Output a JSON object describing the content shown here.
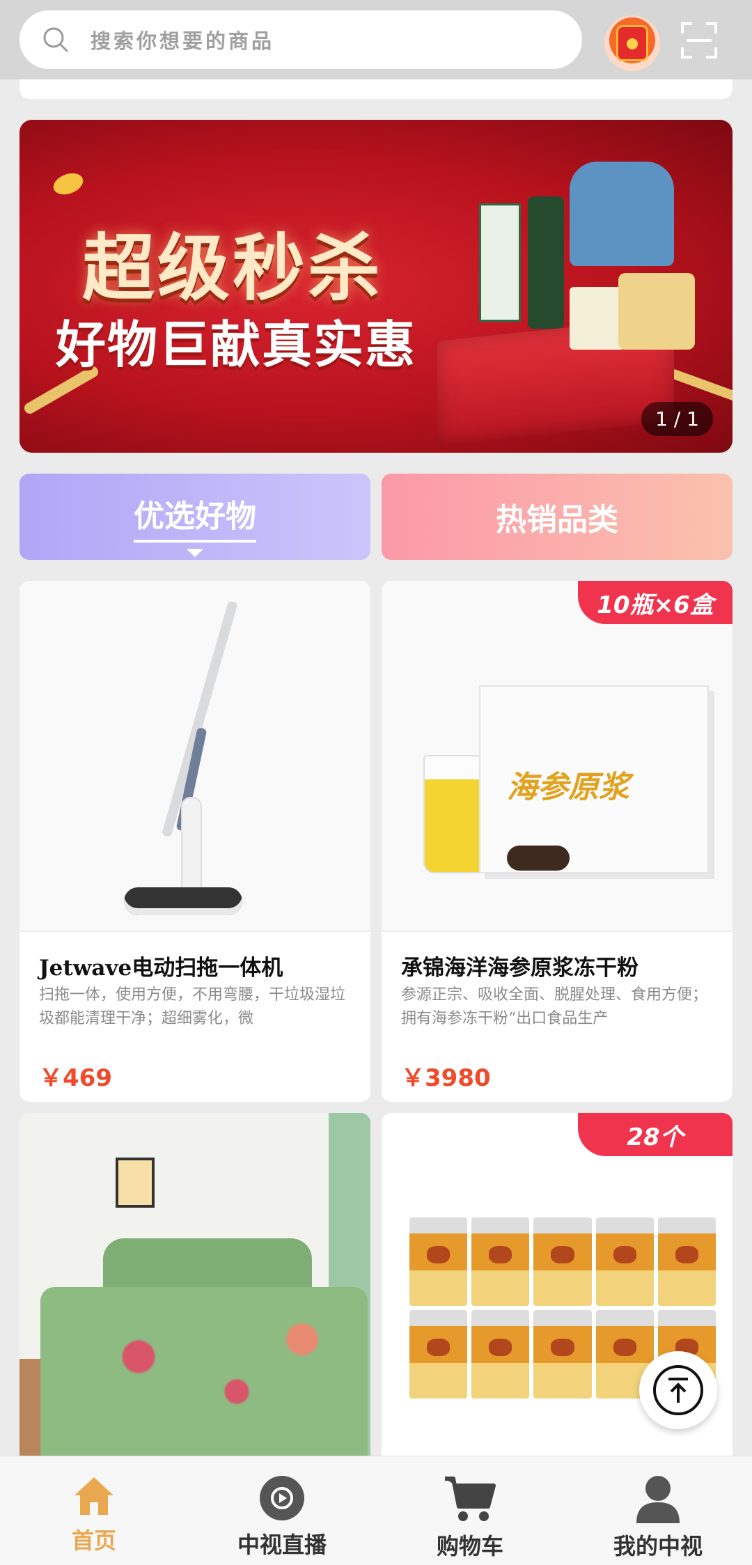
{
  "header": {
    "search_placeholder": "搜索你想要的商品"
  },
  "banner": {
    "title": "超级秒杀",
    "subtitle": "好物巨献真实惠",
    "page_indicator": "1 / 1"
  },
  "tabs": [
    {
      "label": "优选好物",
      "active": true
    },
    {
      "label": "热销品类",
      "active": false
    }
  ],
  "products": [
    {
      "name": "Jetwave电动扫拖一体机",
      "desc": "扫拖一体，使用方便，不用弯腰，干垃圾湿垃圾都能清理干净；超细雾化，微",
      "price": "￥469",
      "tag": ""
    },
    {
      "name": "承锦海洋海参原浆冻干粉",
      "desc": "参源正宗、吸收全面、脱腥处理、食用方便；拥有海参冻干粉“出口食品生产",
      "price": "￥3980",
      "tag": "10瓶×6盒",
      "box_text": "海参原浆"
    },
    {
      "name": "",
      "desc": "",
      "price": "",
      "tag": ""
    },
    {
      "name": "",
      "desc": "",
      "price": "",
      "tag": "28个"
    }
  ],
  "bottom_nav": [
    {
      "label": "首页",
      "icon": "home-icon",
      "active": true
    },
    {
      "label": "中视直播",
      "icon": "live-icon",
      "active": false
    },
    {
      "label": "购物车",
      "icon": "cart-icon",
      "active": false
    },
    {
      "label": "我的中视",
      "icon": "user-icon",
      "active": false
    }
  ],
  "colors": {
    "accent_nav": "#e9a84f",
    "price": "#f04a2a",
    "tag": "#f1344e"
  }
}
